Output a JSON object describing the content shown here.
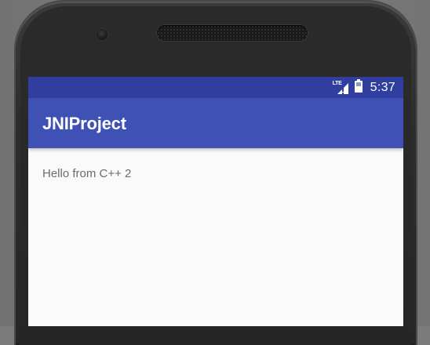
{
  "status_bar": {
    "network_label": "LTE",
    "time": "5:37",
    "icons": [
      "lte-signal-icon",
      "battery-icon"
    ]
  },
  "app_bar": {
    "title": "JNIProject"
  },
  "main": {
    "message": "Hello from C++ 2"
  },
  "colors": {
    "status_bar": "#303f9f",
    "app_bar": "#3f51b5",
    "background": "#fafafa",
    "text": "#6b6b6b"
  }
}
